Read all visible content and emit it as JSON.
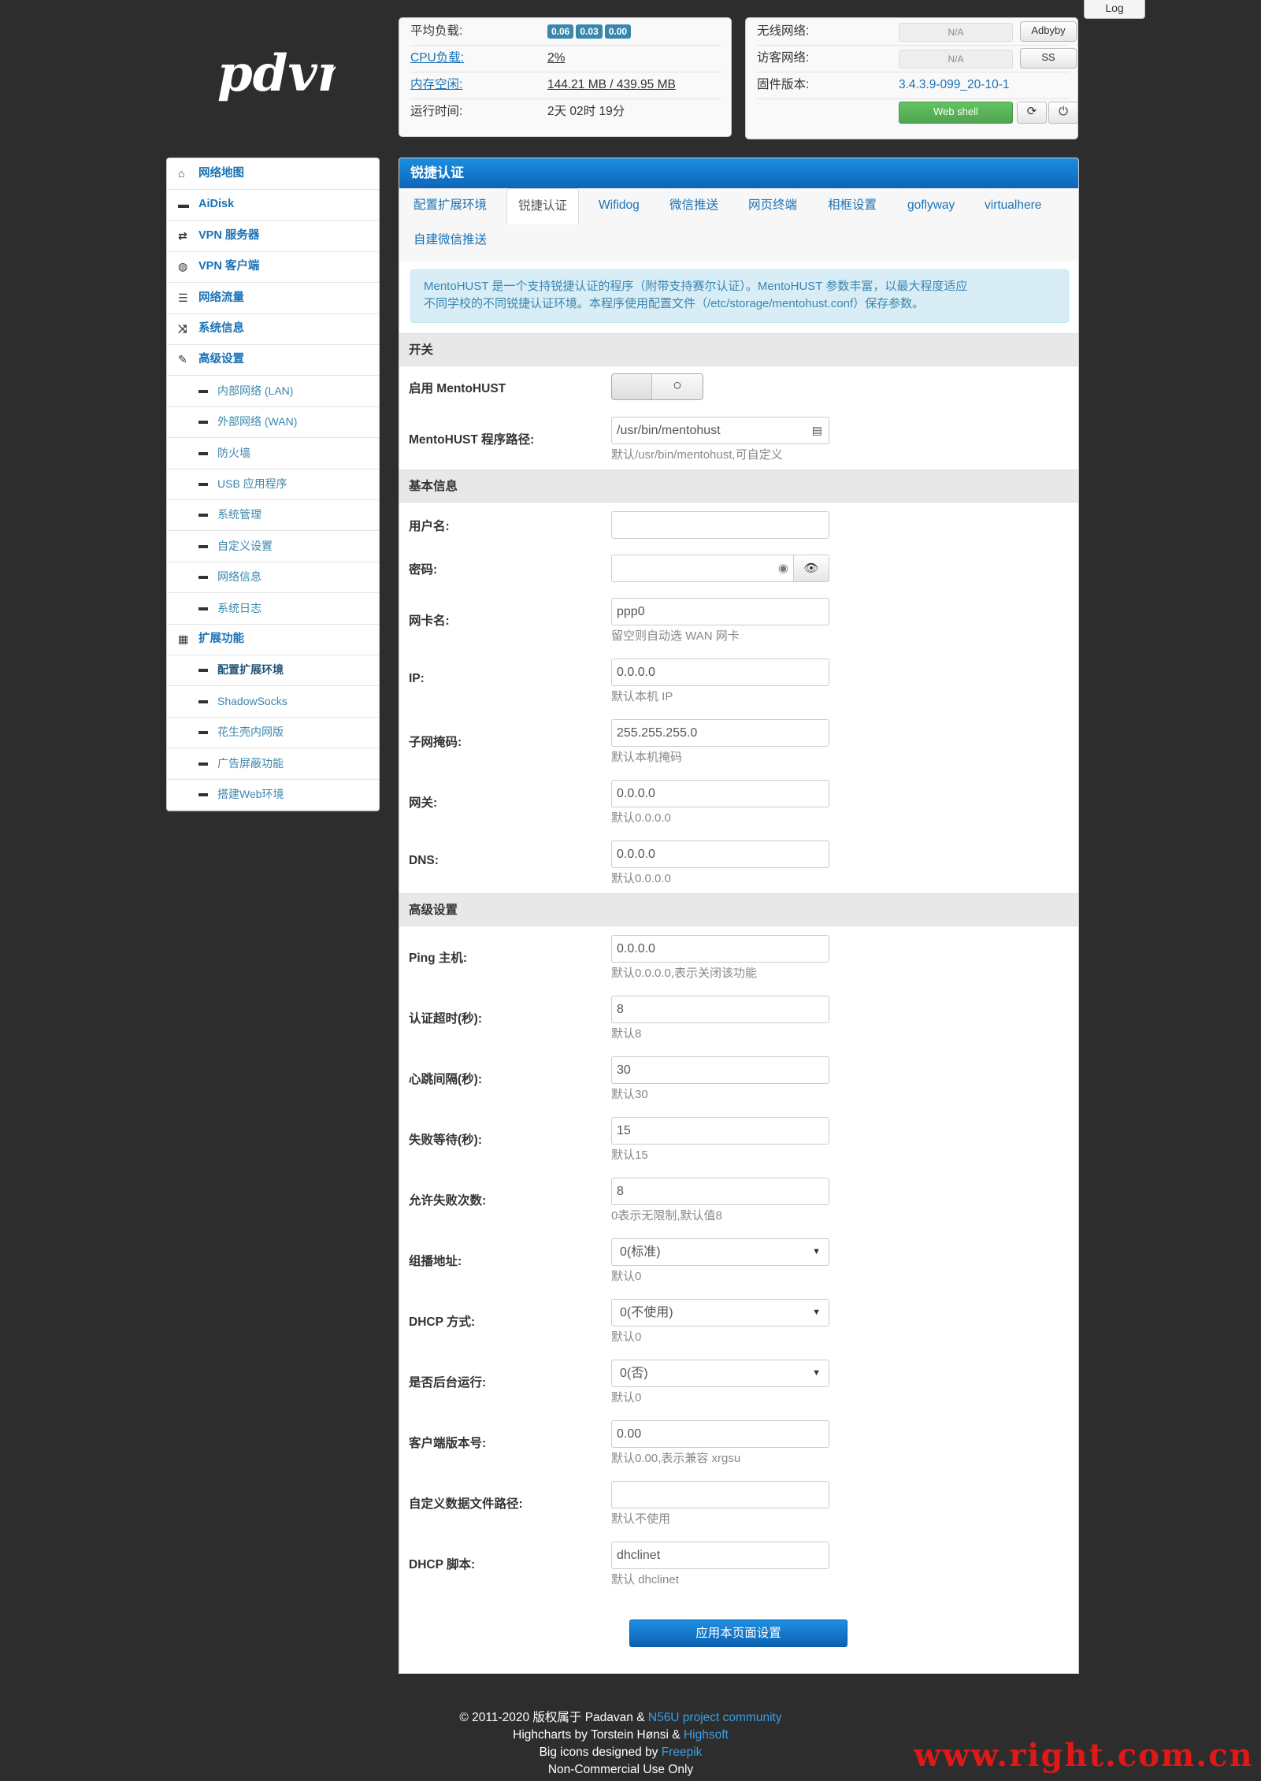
{
  "top_right": {
    "log_label": "Log"
  },
  "logo": {
    "text": "pdvn"
  },
  "status": {
    "load_label": "平均负载:",
    "load_values": [
      "0.06",
      "0.03",
      "0.00"
    ],
    "cpu_label": "CPU负载:",
    "cpu_value": "2%",
    "mem_label": "内存空闲:",
    "mem_value": "144.21 MB / 439.95 MB",
    "uptime_label": "运行时间:",
    "uptime_value": "2天 02时 19分",
    "wireless_label": "无线网络:",
    "wireless_value": "N/A",
    "adbyby_button": "Adbyby",
    "guest_label": "访客网络:",
    "guest_value": "N/A",
    "ss_button": "SS",
    "firmware_label": "固件版本:",
    "firmware_value": "3.4.3.9-099_20-10-1",
    "webshell_button": "Web shell"
  },
  "sidebar": {
    "items": [
      {
        "label": "网络地图",
        "icon": "home-icon",
        "type": "top"
      },
      {
        "label": "AiDisk",
        "icon": "hdd-icon",
        "type": "top"
      },
      {
        "label": "VPN 服务器",
        "icon": "retweet-icon",
        "type": "top"
      },
      {
        "label": "VPN 客户端",
        "icon": "globe-icon",
        "type": "top"
      },
      {
        "label": "网络流量",
        "icon": "tasks-icon",
        "type": "top"
      },
      {
        "label": "系统信息",
        "icon": "random-icon",
        "type": "top"
      },
      {
        "label": "高级设置",
        "icon": "wrench-icon",
        "type": "top"
      },
      {
        "label": "内部网络 (LAN)",
        "type": "sub"
      },
      {
        "label": "外部网络 (WAN)",
        "type": "sub"
      },
      {
        "label": "防火墙",
        "type": "sub"
      },
      {
        "label": "USB 应用程序",
        "type": "sub"
      },
      {
        "label": "系统管理",
        "type": "sub"
      },
      {
        "label": "自定义设置",
        "type": "sub"
      },
      {
        "label": "网络信息",
        "type": "sub"
      },
      {
        "label": "系统日志",
        "type": "sub"
      },
      {
        "label": "扩展功能",
        "icon": "th-icon",
        "type": "top"
      },
      {
        "label": "配置扩展环境",
        "type": "sub-bold"
      },
      {
        "label": "ShadowSocks",
        "type": "sub"
      },
      {
        "label": "花生壳内网版",
        "type": "sub"
      },
      {
        "label": "广告屏蔽功能",
        "type": "sub"
      },
      {
        "label": "搭建Web环境",
        "type": "sub"
      }
    ]
  },
  "main": {
    "title": "锐捷认证",
    "tabs": [
      "配置扩展环境",
      "锐捷认证",
      "Wifidog",
      "微信推送",
      "网页终端",
      "相框设置",
      "goflyway",
      "virtualhere",
      "自建微信推送"
    ],
    "info_line1": "MentoHUST 是一个支持锐捷认证的程序（附带支持赛尔认证）。MentoHUST 参数丰富，以最大程度适应",
    "info_line2": "不同学校的不同锐捷认证环境。本程序使用配置文件（/etc/storage/mentohust.conf）保存参数。",
    "sections": {
      "switch": "开关",
      "basic": "基本信息",
      "advanced": "高级设置"
    },
    "fields": {
      "enable_label": "启用 MentoHUST",
      "path_label": "MentoHUST 程序路径:",
      "path_value": "/usr/bin/mentohust",
      "path_hint": "默认/usr/bin/mentohust,可自定义",
      "user_label": "用户名:",
      "user_value": "",
      "pass_label": "密码:",
      "pass_value": "",
      "nic_label": "网卡名:",
      "nic_value": "ppp0",
      "nic_hint": "留空则自动选 WAN 网卡",
      "ip_label": "IP:",
      "ip_value": "0.0.0.0",
      "ip_hint": "默认本机 IP",
      "mask_label": "子网掩码:",
      "mask_value": "255.255.255.0",
      "mask_hint": "默认本机掩码",
      "gw_label": "网关:",
      "gw_value": "0.0.0.0",
      "gw_hint": "默认0.0.0.0",
      "dns_label": "DNS:",
      "dns_value": "0.0.0.0",
      "dns_hint": "默认0.0.0.0",
      "ping_label": "Ping 主机:",
      "ping_value": "0.0.0.0",
      "ping_hint": "默认0.0.0.0,表示关闭该功能",
      "timeout_label": "认证超时(秒):",
      "timeout_value": "8",
      "timeout_hint": "默认8",
      "heartbeat_label": "心跳间隔(秒):",
      "heartbeat_value": "30",
      "heartbeat_hint": "默认30",
      "failwait_label": "失败等待(秒):",
      "failwait_value": "15",
      "failwait_hint": "默认15",
      "maxfail_label": "允许失败次数:",
      "maxfail_value": "8",
      "maxfail_hint": "0表示无限制,默认值8",
      "multicast_label": "组播地址:",
      "multicast_value": "0(标准)",
      "multicast_hint": "默认0",
      "dhcp_label": "DHCP 方式:",
      "dhcp_value": "0(不使用)",
      "dhcp_hint": "默认0",
      "daemon_label": "是否后台运行:",
      "daemon_value": "0(否)",
      "daemon_hint": "默认0",
      "ver_label": "客户端版本号:",
      "ver_value": "0.00",
      "ver_hint": "默认0.00,表示兼容 xrgsu",
      "datafile_label": "自定义数据文件路径:",
      "datafile_value": "",
      "datafile_hint": "默认不使用",
      "dhcpscript_label": "DHCP 脚本:",
      "dhcpscript_value": "dhclinet",
      "dhcpscript_hint": "默认 dhclinet"
    },
    "apply_button": "应用本页面设置"
  },
  "footer": {
    "line1_a": "© 2011-2020 版权属于 Padavan & ",
    "line1_link": "N56U project community",
    "line2_a": "Highcharts by Torstein Hønsi & ",
    "line2_link": "Highsoft",
    "line3_a": "Big icons designed by ",
    "line3_link": "Freepik",
    "line4": "Non-Commercial Use Only"
  },
  "watermark": "www.right.com.cn"
}
